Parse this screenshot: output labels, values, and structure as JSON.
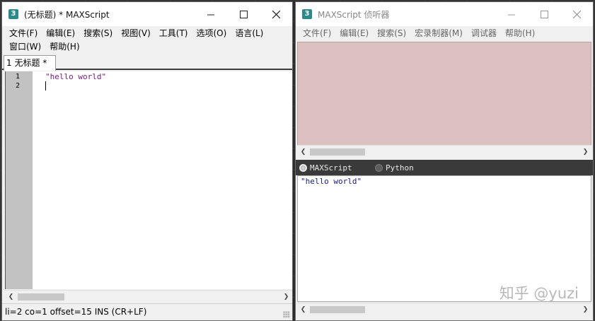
{
  "editor": {
    "title": "(无标题) * MAXScript",
    "menu": [
      "文件(F)",
      "编辑(E)",
      "搜索(S)",
      "视图(V)",
      "工具(T)",
      "选项(O)",
      "语言(L)",
      "窗口(W)",
      "帮助(H)"
    ],
    "tab_label": "1 无标题 *",
    "line_numbers": [
      "1",
      "2"
    ],
    "code_lines": [
      "\"hello world\""
    ],
    "status": "li=2 co=1 offset=15 INS (CR+LF)"
  },
  "listener": {
    "title": "MAXScript 侦听器",
    "menu": [
      "文件(F)",
      "编辑(E)",
      "搜索(S)",
      "宏录制器(M)",
      "调试器",
      "帮助(H)"
    ],
    "languages": [
      {
        "label": "MAXScript",
        "selected": true
      },
      {
        "label": "Python",
        "selected": false
      }
    ],
    "output_lines": [
      "\"hello world\""
    ]
  },
  "watermark": "知乎 @yuzi",
  "icons": {
    "app": "maxscript-app-icon",
    "minimize": "minimize-icon",
    "maximize": "maximize-icon",
    "close": "close-icon"
  },
  "colors": {
    "macro_pane_bg": "#dcc1c1",
    "code_string": "#7a1a7a",
    "gutter": "#c2c2c2"
  }
}
